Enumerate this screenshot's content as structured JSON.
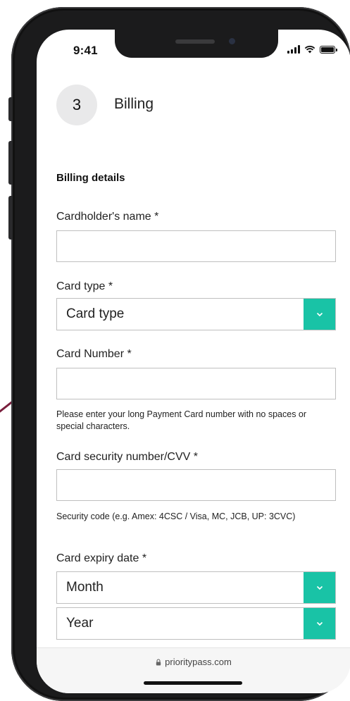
{
  "status_bar": {
    "time": "9:41",
    "icons": [
      "signal-icon",
      "wifi-icon",
      "battery-icon"
    ]
  },
  "step": {
    "number": "3",
    "title": "Billing"
  },
  "form": {
    "section_heading": "Billing details",
    "cardholder_name": {
      "label": "Cardholder's name *",
      "value": ""
    },
    "card_type": {
      "label": "Card type *",
      "selected": "Card type"
    },
    "card_number": {
      "label": "Card Number *",
      "value": "",
      "help": "Please enter your long Payment Card number with no spaces or special characters."
    },
    "cvv": {
      "label": "Card security number/CVV *",
      "value": "",
      "help": "Security code (e.g. Amex: 4CSC / Visa, MC, JCB, UP: 3CVC)"
    },
    "expiry": {
      "label": "Card expiry date *",
      "month": "Month",
      "year": "Year"
    }
  },
  "browser": {
    "url": "prioritypass.com"
  },
  "colors": {
    "accent": "#19c3a6",
    "step_circle": "#e9e9ea",
    "frame": "#1b1b1c",
    "decorative_line": "#7a1f3d"
  }
}
